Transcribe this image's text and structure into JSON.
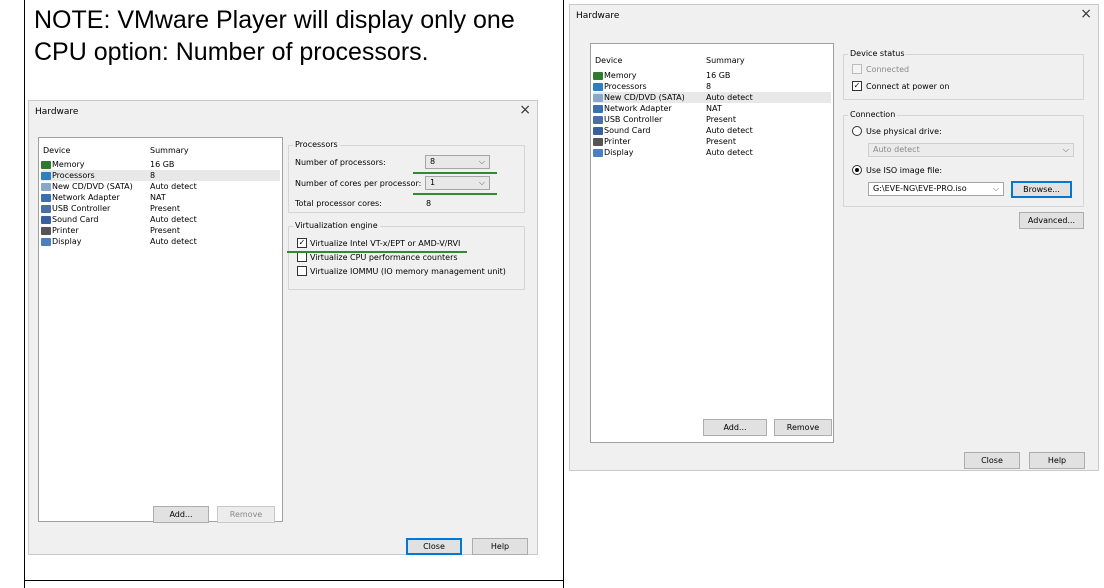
{
  "note": {
    "line1": "NOTE: VMware Player will display only one",
    "line2": "CPU option: Number of processors."
  },
  "left_dialog": {
    "title": "Hardware",
    "close_glyph": "×",
    "device_header": "Device",
    "summary_header": "Summary",
    "devices": [
      {
        "name": "Memory",
        "summary": "16 GB",
        "icon": "memory-icon",
        "color": "#2f7a2f"
      },
      {
        "name": "Processors",
        "summary": "8",
        "icon": "processor-icon",
        "color": "#2d7fc1"
      },
      {
        "name": "New CD/DVD (SATA)",
        "summary": "Auto detect",
        "icon": "cd-icon",
        "color": "#8aa7c9"
      },
      {
        "name": "Network Adapter",
        "summary": "NAT",
        "icon": "network-icon",
        "color": "#3b6fb0"
      },
      {
        "name": "USB Controller",
        "summary": "Present",
        "icon": "usb-icon",
        "color": "#4a6fa8"
      },
      {
        "name": "Sound Card",
        "summary": "Auto detect",
        "icon": "sound-icon",
        "color": "#3a5fa0"
      },
      {
        "name": "Printer",
        "summary": "Present",
        "icon": "printer-icon",
        "color": "#555555"
      },
      {
        "name": "Display",
        "summary": "Auto detect",
        "icon": "display-icon",
        "color": "#4a7fc0"
      }
    ],
    "selected_device": "Processors",
    "processors_group": "Processors",
    "num_processors_label": "Number of processors:",
    "num_processors_value": "8",
    "cores_label": "Number of cores per processor:",
    "cores_value": "1",
    "total_cores_label": "Total processor cores:",
    "total_cores_value": "8",
    "virt_group": "Virtualization engine",
    "virt_options": [
      {
        "label": "Virtualize Intel VT-x/EPT or AMD-V/RVI",
        "checked": true
      },
      {
        "label": "Virtualize CPU performance counters",
        "checked": false
      },
      {
        "label": "Virtualize IOMMU (IO memory management unit)",
        "checked": false
      }
    ],
    "add_label": "Add...",
    "remove_label": "Remove",
    "close_label": "Close",
    "help_label": "Help",
    "highlight_color": "#2e8b2e"
  },
  "right_dialog": {
    "title": "Hardware",
    "close_glyph": "×",
    "device_header": "Device",
    "summary_header": "Summary",
    "devices": [
      {
        "name": "Memory",
        "summary": "16 GB",
        "icon": "memory-icon",
        "color": "#2f7a2f"
      },
      {
        "name": "Processors",
        "summary": "8",
        "icon": "processor-icon",
        "color": "#2d7fc1"
      },
      {
        "name": "New CD/DVD (SATA)",
        "summary": "Auto detect",
        "icon": "cd-icon",
        "color": "#8aa7c9"
      },
      {
        "name": "Network Adapter",
        "summary": "NAT",
        "icon": "network-icon",
        "color": "#3b6fb0"
      },
      {
        "name": "USB Controller",
        "summary": "Present",
        "icon": "usb-icon",
        "color": "#4a6fa8"
      },
      {
        "name": "Sound Card",
        "summary": "Auto detect",
        "icon": "sound-icon",
        "color": "#3a5fa0"
      },
      {
        "name": "Printer",
        "summary": "Present",
        "icon": "printer-icon",
        "color": "#555555"
      },
      {
        "name": "Display",
        "summary": "Auto detect",
        "icon": "display-icon",
        "color": "#4a7fc0"
      }
    ],
    "selected_device": "New CD/DVD (SATA)",
    "device_status_group": "Device status",
    "connected_label": "Connected",
    "connect_power_label": "Connect at power on",
    "connection_group": "Connection",
    "physical_label": "Use physical drive:",
    "physical_value": "Auto detect",
    "iso_label": "Use ISO image file:",
    "iso_value": "G:\\EVE-NG\\EVE-PRO.iso",
    "browse_label": "Browse...",
    "advanced_label": "Advanced...",
    "add_label": "Add...",
    "remove_label": "Remove",
    "close_label": "Close",
    "help_label": "Help"
  }
}
